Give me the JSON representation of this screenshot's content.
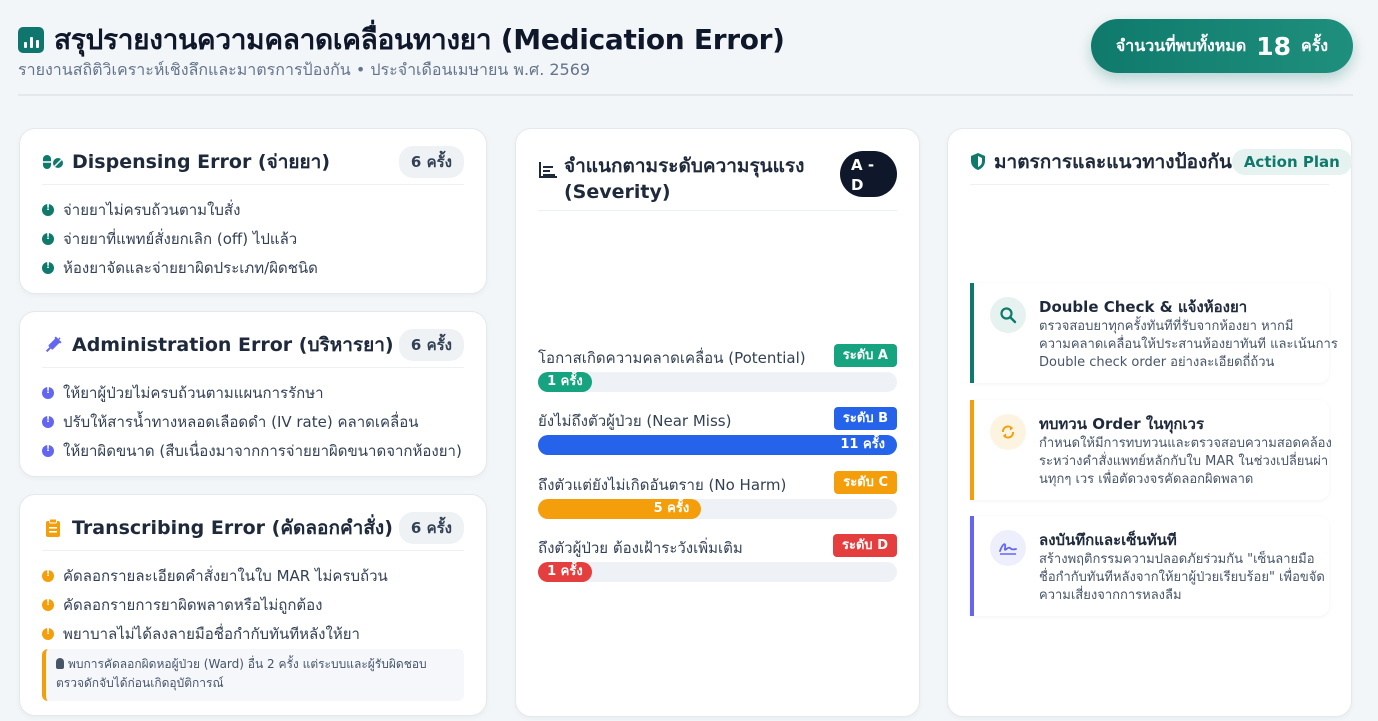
{
  "header": {
    "title": "สรุปรายงานความคลาดเคลื่อนทางยา (Medication Error)",
    "subtitle": "รายงานสถิติวิเคราะห์เชิงลึกและมาตรการป้องกัน • ประจำเดือนเมษายน พ.ศ. 2569",
    "total_label": "จำนวนที่พบทั้งหมด",
    "total_value": "18",
    "total_unit": "ครั้ง"
  },
  "error_types": [
    {
      "title": "Dispensing Error (จ่ายยา)",
      "count": "6 ครั้ง",
      "icon": "pills-icon",
      "items": [
        "จ่ายยาไม่ครบถ้วนตามใบสั่ง",
        "จ่ายยาที่แพทย์สั่งยกเลิก (off) ไปแล้ว",
        "ห้องยาจัดและจ่ายยาผิดประเภท/ผิดชนิด"
      ]
    },
    {
      "title": "Administration Error (บริหารยา)",
      "count": "6 ครั้ง",
      "icon": "syringe-icon",
      "items": [
        "ให้ยาผู้ป่วยไม่ครบถ้วนตามแผนการรักษา",
        "ปรับให้สารน้ำทางหลอดเลือดดำ (IV rate) คลาดเคลื่อน",
        "ให้ยาผิดขนาด (สืบเนื่องมาจากการจ่ายยาผิดขนาดจากห้องยา)"
      ]
    },
    {
      "title": "Transcribing Error (คัดลอกคำสั่ง)",
      "count": "6 ครั้ง",
      "icon": "clipboard-icon",
      "items": [
        "คัดลอกรายละเอียดคำสั่งยาในใบ MAR ไม่ครบถ้วน",
        "คัดลอกรายการยาผิดพลาดหรือไม่ถูกต้อง",
        "พยาบาลไม่ได้ลงลายมือชื่อกำกับทันทีหลังให้ยา"
      ],
      "note_line1": "พบการคัดลอกผิดหอผู้ป่วย (Ward) อื่น 2 ครั้ง แต่ระบบและผู้รับผิดชอบ",
      "note_line2": "ตรวจดักจับได้ก่อนเกิดอุบัติการณ์"
    }
  ],
  "severity": {
    "title_line1": "จำแนกตามระดับความรุนแรง",
    "title_line2": "(Severity)",
    "badge_line1": "A -",
    "badge_line2": "D",
    "levels": [
      {
        "label": "โอกาสเกิดความคลาดเคลื่อน (Potential)",
        "tag": "ระดับ A",
        "count_text": "1 ครั้ง",
        "count": 1,
        "color": "#16a37f"
      },
      {
        "label": "ยังไม่ถึงตัวผู้ป่วย (Near Miss)",
        "tag": "ระดับ B",
        "count_text": "11 ครั้ง",
        "count": 11,
        "color": "#2563eb"
      },
      {
        "label": "ถึงตัวแต่ยังไม่เกิดอันตราย (No Harm)",
        "tag": "ระดับ C",
        "count_text": "5 ครั้ง",
        "count": 5,
        "color": "#f59e0b"
      },
      {
        "label": "ถึงตัวผู้ป่วย ต้องเฝ้าระวังเพิ่มเติม",
        "tag": "ระดับ D",
        "count_text": "1 ครั้ง",
        "count": 1,
        "color": "#e53e3e"
      }
    ]
  },
  "prevention": {
    "title": "มาตรการและแนวทางป้องกัน",
    "badge": "Action Plan",
    "measures": [
      {
        "title": "Double Check & แจ้งห้องยา",
        "desc_lines": [
          "ตรวจสอบยาทุกครั้งทันทีที่รับจากห้องยา หากมี",
          "ความคลาดเคลื่อนให้ประสานห้องยาทันที และเน้นการ",
          "Double check order อย่างละเอียดถี่ถ้วน"
        ],
        "color": "#0f7a6c",
        "icon": "search-icon"
      },
      {
        "title": "ทบทวน Order ในทุกเวร",
        "desc_lines": [
          "กำหนดให้มีการทบทวนและตรวจสอบความสอดคล้อง",
          "ระหว่างคำสั่งแพทย์หลักกับใบ MAR ในช่วงเปลี่ยนผ่า",
          "นทุกๆ เวร เพื่อตัดวงจรคัดลอกผิดพลาด"
        ],
        "color": "#f59e0b",
        "icon": "refresh-icon"
      },
      {
        "title": "ลงบันทึกและเซ็นทันที",
        "desc_lines": [
          "สร้างพฤติกรรมความปลอดภัยร่วมกัน \"เซ็นลายมือ",
          "ชื่อกำกับทันทีหลังจากให้ยาผู้ป่วยเรียบร้อย\" เพื่อขจัด",
          "ความเสี่ยงจากการหลงลืม"
        ],
        "color": "#6366f1",
        "icon": "signature-icon"
      }
    ]
  }
}
